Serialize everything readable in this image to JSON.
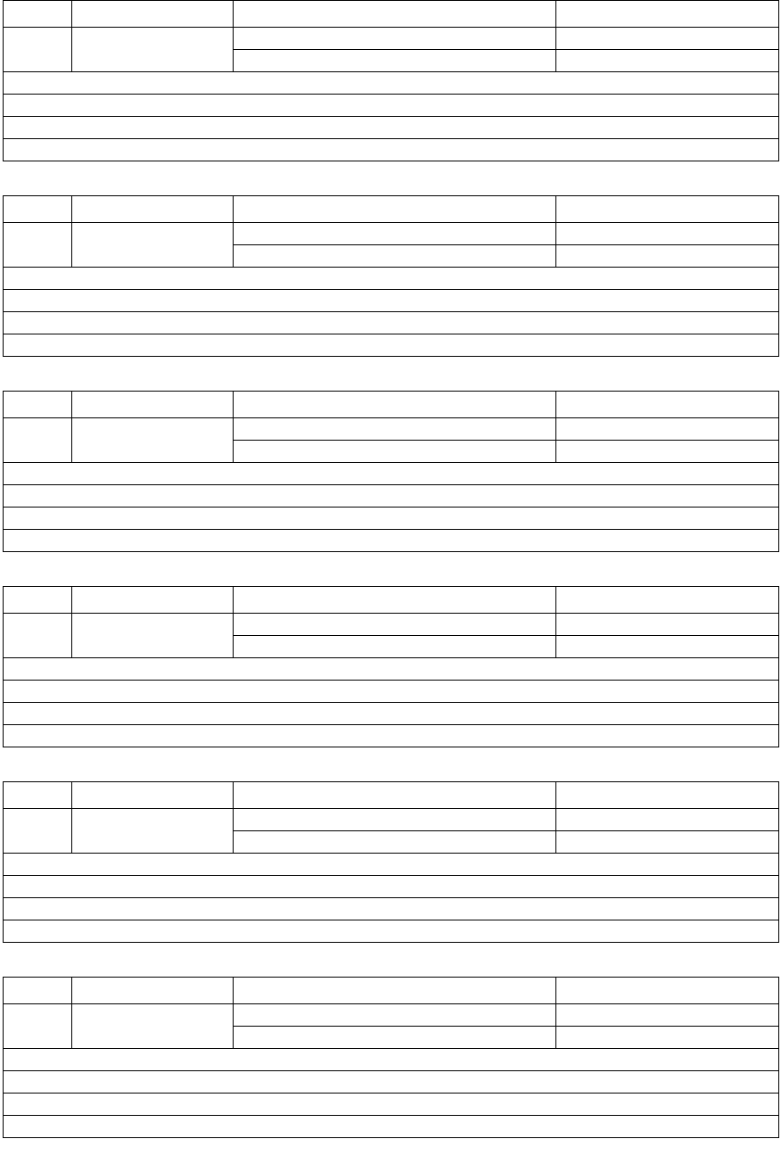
{
  "blocks": [
    {
      "header": [
        {
          "a": "",
          "b": "",
          "c": "",
          "d": ""
        },
        {
          "a": "",
          "b": "",
          "c": "",
          "d": ""
        },
        {
          "c": "",
          "d": ""
        }
      ],
      "rows": [
        "",
        "",
        "",
        ""
      ]
    },
    {
      "header": [
        {
          "a": "",
          "b": "",
          "c": "",
          "d": ""
        },
        {
          "a": "",
          "b": "",
          "c": "",
          "d": ""
        },
        {
          "c": "",
          "d": ""
        }
      ],
      "rows": [
        "",
        "",
        "",
        ""
      ]
    },
    {
      "header": [
        {
          "a": "",
          "b": "",
          "c": "",
          "d": ""
        },
        {
          "a": "",
          "b": "",
          "c": "",
          "d": ""
        },
        {
          "c": "",
          "d": ""
        }
      ],
      "rows": [
        "",
        "",
        "",
        ""
      ]
    },
    {
      "header": [
        {
          "a": "",
          "b": "",
          "c": "",
          "d": ""
        },
        {
          "a": "",
          "b": "",
          "c": "",
          "d": ""
        },
        {
          "c": "",
          "d": ""
        }
      ],
      "rows": [
        "",
        "",
        "",
        ""
      ]
    },
    {
      "header": [
        {
          "a": "",
          "b": "",
          "c": "",
          "d": ""
        },
        {
          "a": "",
          "b": "",
          "c": "",
          "d": ""
        },
        {
          "c": "",
          "d": ""
        }
      ],
      "rows": [
        "",
        "",
        "",
        ""
      ]
    },
    {
      "header": [
        {
          "a": "",
          "b": "",
          "c": "",
          "d": ""
        },
        {
          "a": "",
          "b": "",
          "c": "",
          "d": ""
        },
        {
          "c": "",
          "d": ""
        }
      ],
      "rows": [
        "",
        "",
        "",
        ""
      ]
    }
  ]
}
